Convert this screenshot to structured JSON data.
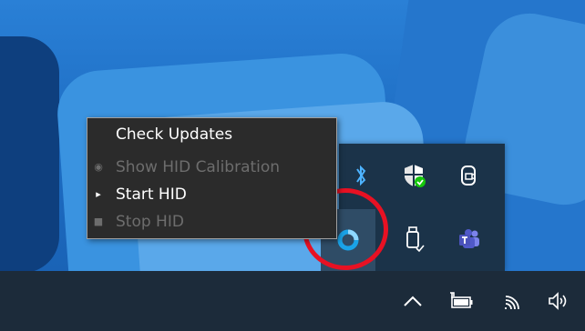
{
  "context_menu": {
    "items": [
      {
        "label": "Check Updates",
        "enabled": true,
        "bullet": ""
      },
      {
        "label": "Show HID Calibration",
        "enabled": false,
        "bullet": "◉"
      },
      {
        "label": "Start HID",
        "enabled": true,
        "bullet": "▸"
      },
      {
        "label": "Stop HID",
        "enabled": false,
        "bullet": "■"
      }
    ]
  },
  "tray_flyout": {
    "icons": [
      {
        "name": "bluetooth-icon"
      },
      {
        "name": "windows-security-icon"
      },
      {
        "name": "meet-now-icon"
      },
      {
        "name": "hid-app-icon",
        "highlighted": true
      },
      {
        "name": "usb-eject-icon"
      },
      {
        "name": "teams-icon"
      }
    ]
  },
  "taskbar": {
    "icons": [
      {
        "name": "chevron-up-icon"
      },
      {
        "name": "battery-icon"
      },
      {
        "name": "wifi-icon"
      },
      {
        "name": "volume-icon"
      }
    ]
  },
  "colors": {
    "highlight": "#e81123",
    "menu_bg": "#2b2b2b",
    "taskbar_bg": "#1c2b3a",
    "flyout_bg": "#1b3349"
  }
}
